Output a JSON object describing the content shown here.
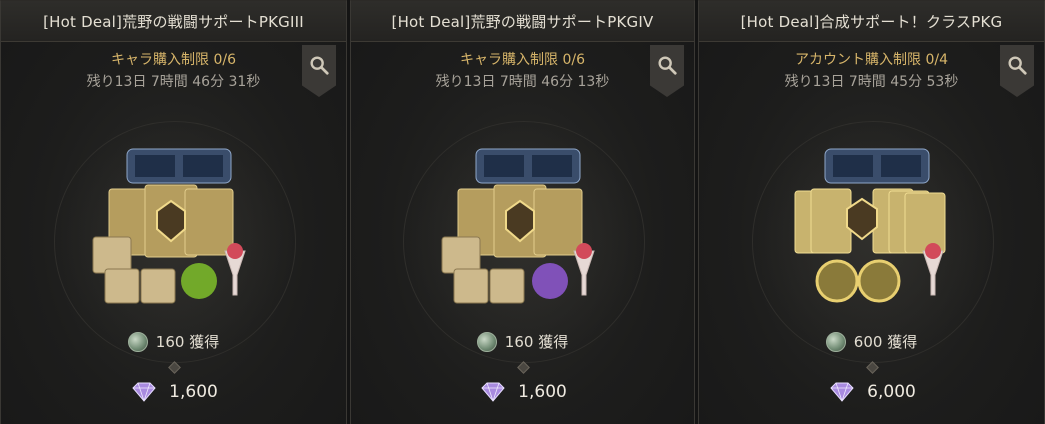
{
  "cards": [
    {
      "title": "[Hot Deal]荒野の戦闘サポートPKGIII",
      "limit": "キャラ購入制限 0/6",
      "timer": "残り13日 7時間 46分 31秒",
      "reward": "160 獲得",
      "price": "1,600",
      "potion_color": "#7fbf2a"
    },
    {
      "title": "[Hot Deal]荒野の戦闘サポートPKGIV",
      "limit": "キャラ購入制限 0/6",
      "timer": "残り13日 7時間 46分 13秒",
      "reward": "160 獲得",
      "price": "1,600",
      "potion_color": "#8a55c9"
    },
    {
      "title": "[Hot Deal]合成サポート！クラスPKG",
      "limit": "アカウント購入制限 0/4",
      "timer": "残り13日 7時間 45分 53秒",
      "reward": "600 獲得",
      "price": "6,000",
      "potion_color": "#c9a64a"
    }
  ],
  "icons": {
    "search": "search-icon",
    "currency_reward": "silver-coin-icon",
    "currency_price": "crystal-gem-icon"
  },
  "colors": {
    "limit_text": "#d7b56a",
    "timer_text": "#a8a39a",
    "card_bg": "#1d1d1c"
  }
}
